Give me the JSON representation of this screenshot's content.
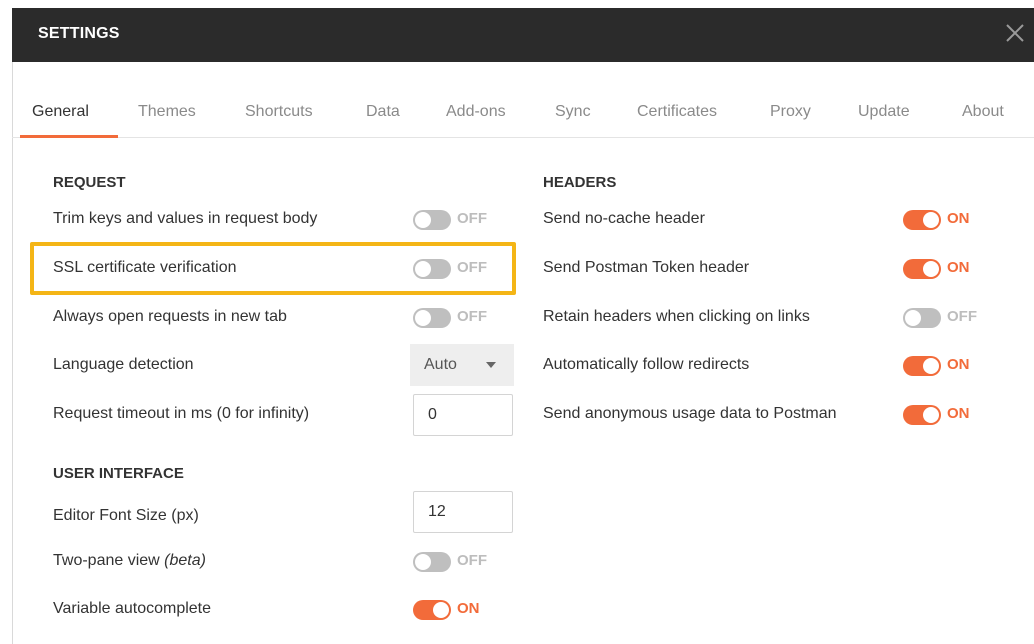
{
  "window": {
    "title": "SETTINGS",
    "close_icon": "close-icon"
  },
  "tabs": [
    {
      "label": "General",
      "active": true
    },
    {
      "label": "Themes"
    },
    {
      "label": "Shortcuts"
    },
    {
      "label": "Data"
    },
    {
      "label": "Add-ons"
    },
    {
      "label": "Sync"
    },
    {
      "label": "Certificates"
    },
    {
      "label": "Proxy"
    },
    {
      "label": "Update"
    },
    {
      "label": "About"
    }
  ],
  "request": {
    "title": "REQUEST",
    "trim_keys": {
      "label": "Trim keys and values in request body",
      "state": "OFF"
    },
    "ssl_verification": {
      "label": "SSL certificate verification",
      "state": "OFF"
    },
    "open_new_tab": {
      "label": "Always open requests in new tab",
      "state": "OFF"
    },
    "language_detection": {
      "label": "Language detection",
      "value": "Auto"
    },
    "timeout": {
      "label": "Request timeout in ms (0 for infinity)",
      "value": "0"
    }
  },
  "user_interface": {
    "title": "USER INTERFACE",
    "font_size": {
      "label": "Editor Font Size (px)",
      "value": "12"
    },
    "two_pane": {
      "label": "Two-pane view ",
      "label_em": "(beta)",
      "state": "OFF"
    },
    "autocomplete": {
      "label": "Variable autocomplete",
      "state": "ON"
    }
  },
  "headers": {
    "title": "HEADERS",
    "no_cache": {
      "label": "Send no-cache header",
      "state": "ON"
    },
    "postman_token": {
      "label": "Send Postman Token header",
      "state": "ON"
    },
    "retain_headers": {
      "label": "Retain headers when clicking on links",
      "state": "OFF"
    },
    "follow_redirects": {
      "label": "Automatically follow redirects",
      "state": "ON"
    },
    "usage_data": {
      "label": "Send anonymous usage data to Postman",
      "state": "ON"
    }
  },
  "colors": {
    "accent": "#f26b3a",
    "toggle_off": "#bfbfbf",
    "highlight": "#f4b516",
    "titlebar": "#2b2b2b"
  }
}
